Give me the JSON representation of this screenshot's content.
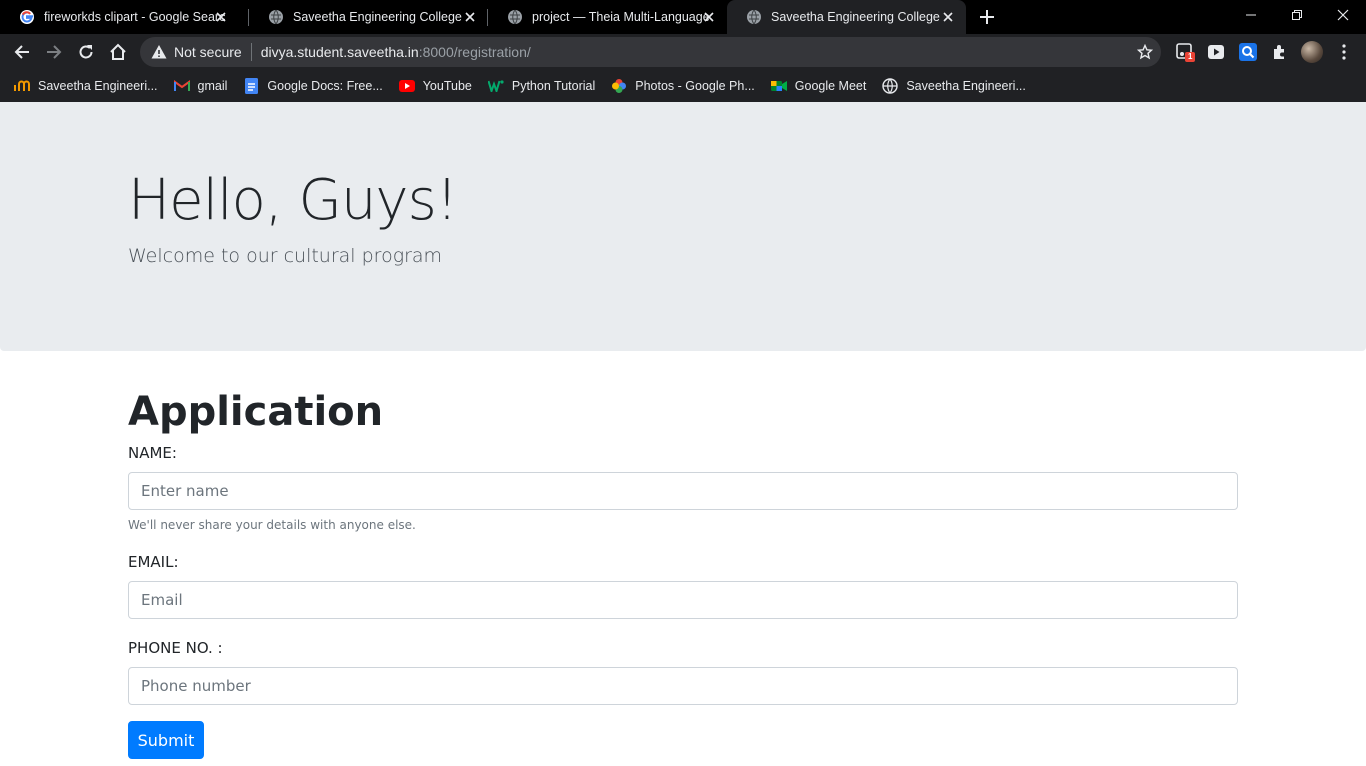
{
  "browser": {
    "tabs": [
      {
        "title": "fireworkds clipart - Google Searc",
        "favicon": "google-icon",
        "active": false
      },
      {
        "title": "Saveetha Engineering College",
        "favicon": "globe-icon",
        "active": false
      },
      {
        "title": "project — Theia Multi-Language",
        "favicon": "globe-icon",
        "active": false
      },
      {
        "title": "Saveetha Engineering College",
        "favicon": "globe-icon",
        "active": true
      }
    ],
    "omnibox": {
      "security_label": "Not secure",
      "host": "divya.student.saveetha.in",
      "path": ":8000/registration/"
    },
    "extension_badge": "1",
    "bookmarks": [
      {
        "label": "Saveetha Engineeri...",
        "icon": "saveetha-icon"
      },
      {
        "label": "gmail",
        "icon": "gmail-icon"
      },
      {
        "label": "Google Docs: Free...",
        "icon": "docs-icon"
      },
      {
        "label": "YouTube",
        "icon": "youtube-icon"
      },
      {
        "label": "Python Tutorial",
        "icon": "w3-icon"
      },
      {
        "label": "Photos - Google Ph...",
        "icon": "photos-icon"
      },
      {
        "label": "Google Meet",
        "icon": "meet-icon"
      },
      {
        "label": "Saveetha Engineeri...",
        "icon": "globe-icon"
      }
    ]
  },
  "page": {
    "hero_title": "Hello, Guys!",
    "hero_lead": "Welcome to our cultural program",
    "form_title": "Application",
    "name_label": "NAME:",
    "name_placeholder": "Enter name",
    "name_help": "We'll never share your details with anyone else.",
    "email_label": "EMAIL:",
    "email_placeholder": "Email",
    "phone_label": "PHONE NO. :",
    "phone_placeholder": "Phone number",
    "submit_label": "Submit"
  },
  "colors": {
    "jumbotron_bg": "#e9ecef",
    "primary": "#007bff",
    "chrome_dark": "#202124"
  }
}
